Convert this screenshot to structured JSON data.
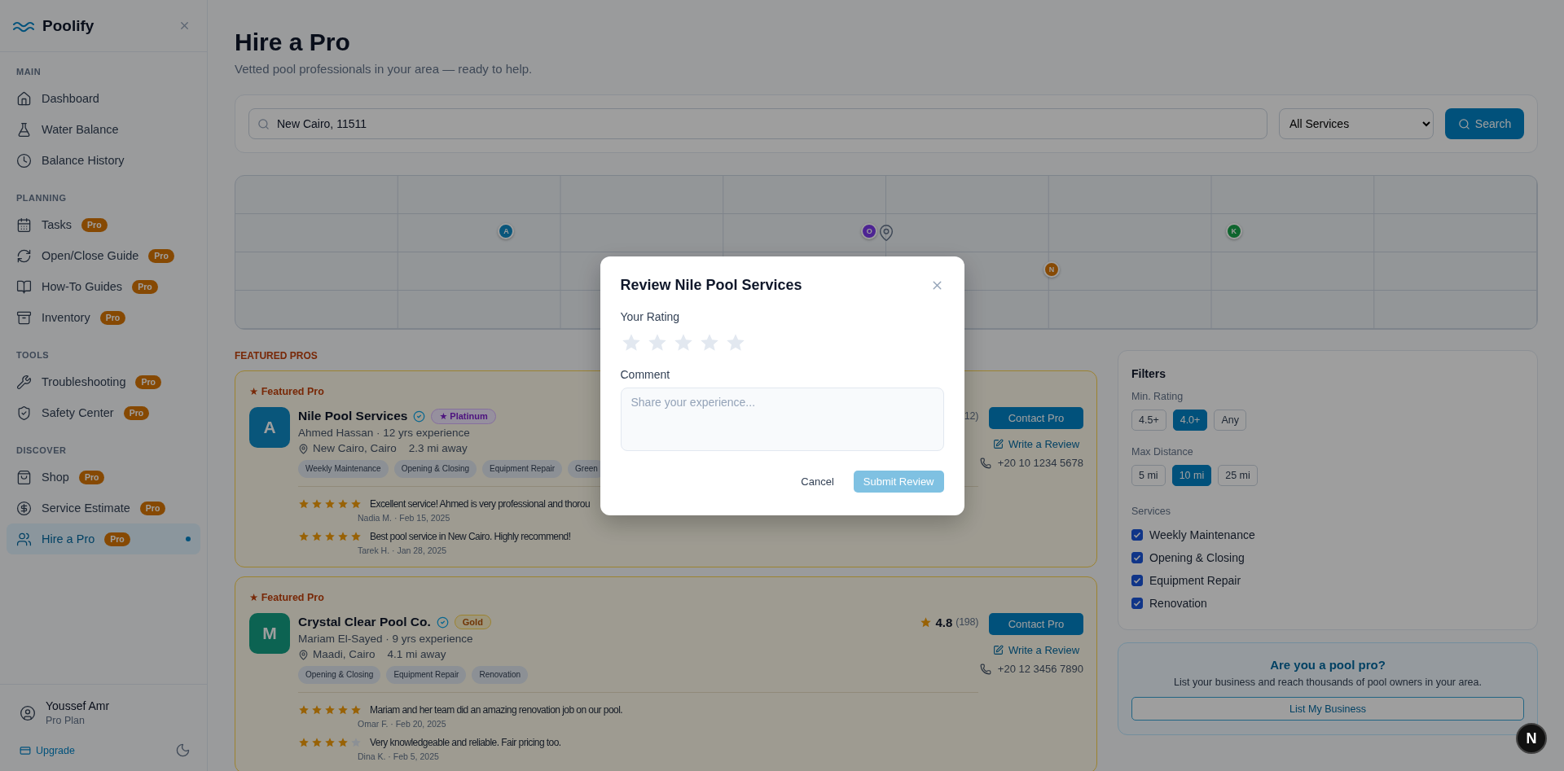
{
  "sidebar": {
    "brand": "Poolify",
    "sections": [
      {
        "title": "MAIN",
        "items": [
          {
            "label": "Dashboard",
            "selected": false
          },
          {
            "label": "Water Balance",
            "selected": false
          },
          {
            "label": "Balance History",
            "selected": false
          }
        ]
      },
      {
        "title": "PLANNING",
        "items": [
          {
            "label": "Tasks",
            "badge": "Pro",
            "selected": false
          },
          {
            "label": "Open/Close Guide",
            "badge": "Pro",
            "selected": false
          },
          {
            "label": "How-To Guides",
            "badge": "Pro",
            "selected": false
          },
          {
            "label": "Inventory",
            "badge": "Pro",
            "selected": false
          }
        ]
      },
      {
        "title": "TOOLS",
        "items": [
          {
            "label": "Troubleshooting",
            "badge": "Pro",
            "selected": false
          },
          {
            "label": "Safety Center",
            "badge": "Pro",
            "selected": false
          }
        ]
      },
      {
        "title": "DISCOVER",
        "items": [
          {
            "label": "Shop",
            "badge": "Pro",
            "selected": false
          },
          {
            "label": "Service Estimate",
            "badge": "Pro",
            "selected": false
          },
          {
            "label": "Hire a Pro",
            "badge": "Pro",
            "selected": true
          }
        ]
      }
    ],
    "user": {
      "name": "Youssef Amr",
      "plan": "Pro Plan"
    },
    "upgrade": "Upgrade"
  },
  "page": {
    "title": "Hire a Pro",
    "subtitle": "Vetted pool professionals in your area — ready to help."
  },
  "search": {
    "value": "New Cairo, 11511",
    "service": "All Services",
    "button": "Search"
  },
  "map": {
    "markers": [
      {
        "label": "A",
        "color": "#09567b"
      },
      {
        "label": "O",
        "color": "#4d2493"
      },
      {
        "label": "K",
        "color": "#0e652e"
      },
      {
        "label": "N",
        "color": "#874a04"
      }
    ]
  },
  "featured": {
    "heading": "FEATURED PROS",
    "pros": [
      {
        "featured_label": "★ Featured Pro",
        "initial": "A",
        "color": "#09567b",
        "name": "Nile Pool Services",
        "verified": true,
        "tier": {
          "kind": "platinum",
          "label": "★ Platinum"
        },
        "owner": "Ahmed Hassan · 12 yrs experience",
        "location": "New Cairo, Cairo",
        "distance": "2.3 mi away",
        "tags": [
          "Weekly Maintenance",
          "Opening & Closing",
          "Equipment Repair",
          "Green"
        ],
        "review_count": "12)",
        "contact": "Contact Pro",
        "write_review": "Write a Review",
        "phone": "+20 10 1234 5678",
        "reviews": [
          {
            "stars": 5,
            "text": "Excellent service! Ahmed is very professional and thorou",
            "meta": "Nadia M. · Feb 15, 2025"
          },
          {
            "stars": 5,
            "text": "Best pool service in New Cairo. Highly recommend!",
            "meta": "Tarek H. · Jan 28, 2025"
          }
        ]
      },
      {
        "featured_label": "★ Featured Pro",
        "initial": "M",
        "color": "#0c6352",
        "name": "Crystal Clear Pool Co.",
        "verified": true,
        "tier": {
          "kind": "gold",
          "label": "Gold"
        },
        "owner": "Mariam El-Sayed · 9 yrs experience",
        "location": "Maadi, Cairo",
        "distance": "4.1 mi away",
        "tags": [
          "Opening & Closing",
          "Equipment Repair",
          "Renovation"
        ],
        "rating": "4.8",
        "review_count": "(198)",
        "contact": "Contact Pro",
        "write_review": "Write a Review",
        "phone": "+20 12 3456 7890",
        "reviews": [
          {
            "stars": 5,
            "text": "Mariam and her team did an amazing renovation job on our pool.",
            "meta": "Omar F. · Feb 20, 2025"
          },
          {
            "stars": 4,
            "text": "Very knowledgeable and reliable. Fair pricing too.",
            "meta": "Dina K. · Feb 5, 2025"
          }
        ]
      }
    ]
  },
  "filters": {
    "title": "Filters",
    "groups": [
      {
        "label": "Min. Rating",
        "options": [
          {
            "label": "4.5+",
            "selected": false
          },
          {
            "label": "4.0+",
            "selected": true
          },
          {
            "label": "Any",
            "selected": false
          }
        ]
      },
      {
        "label": "Max Distance",
        "options": [
          {
            "label": "5 mi",
            "selected": false
          },
          {
            "label": "10 mi",
            "selected": true
          },
          {
            "label": "25 mi",
            "selected": false
          }
        ]
      }
    ],
    "services": {
      "label": "Services",
      "items": [
        {
          "label": "Weekly Maintenance",
          "checked": true
        },
        {
          "label": "Opening & Closing",
          "checked": true
        },
        {
          "label": "Equipment Repair",
          "checked": true
        },
        {
          "label": "Renovation",
          "checked": true
        }
      ]
    }
  },
  "promo": {
    "title": "Are you a pool pro?",
    "text": "List your business and reach thousands of pool owners in your area.",
    "button": "List My Business"
  },
  "modal": {
    "title": "Review Nile Pool Services",
    "rating_label": "Your Rating",
    "stars": 0,
    "comment_label": "Comment",
    "placeholder": "Share your experience...",
    "cancel": "Cancel",
    "submit": {
      "label": "Submit Review",
      "disabled": true
    }
  },
  "dev_badge": "N"
}
